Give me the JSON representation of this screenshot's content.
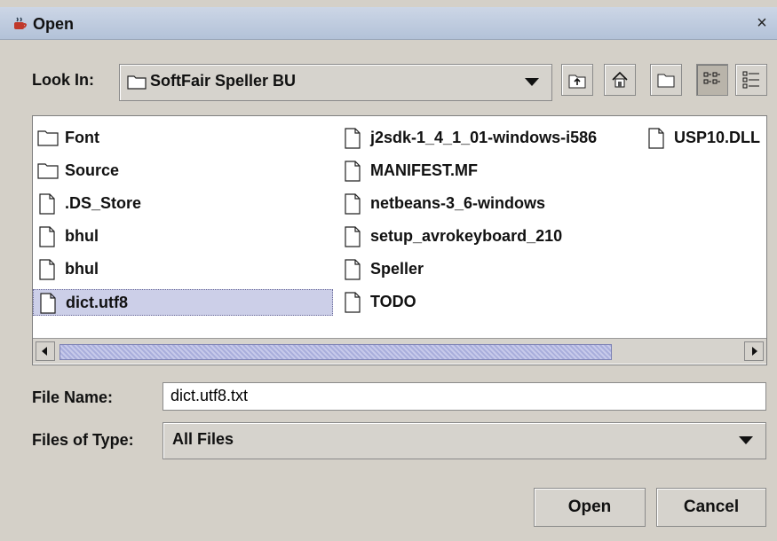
{
  "window": {
    "title": "Open",
    "close_glyph": "×",
    "icon": "java-coffee-cup-icon"
  },
  "look_in": {
    "label": "Look In:",
    "selected_folder": "SoftFair Speller BU",
    "toolbar": {
      "up_icon": "up-one-level-icon",
      "home_icon": "home-icon",
      "new_folder_icon": "new-folder-icon",
      "list_view_icon": "list-view-icon",
      "details_view_icon": "details-view-icon"
    }
  },
  "files": {
    "column1": [
      {
        "name": "Font",
        "type": "folder"
      },
      {
        "name": "Source",
        "type": "folder"
      },
      {
        "name": ".DS_Store",
        "type": "file"
      },
      {
        "name": "bhul",
        "type": "file"
      },
      {
        "name": "bhul",
        "type": "file"
      },
      {
        "name": "dict.utf8",
        "type": "file",
        "selected": true
      }
    ],
    "column2": [
      {
        "name": "j2sdk-1_4_1_01-windows-i586",
        "type": "file"
      },
      {
        "name": "MANIFEST.MF",
        "type": "file"
      },
      {
        "name": "netbeans-3_6-windows",
        "type": "file"
      },
      {
        "name": "setup_avrokeyboard_210",
        "type": "file"
      },
      {
        "name": "Speller",
        "type": "file"
      },
      {
        "name": "TODO",
        "type": "file"
      }
    ],
    "column3": [
      {
        "name": "USP10.DLL",
        "type": "file"
      }
    ]
  },
  "file_name": {
    "label": "File Name:",
    "value": "dict.utf8.txt"
  },
  "files_of_type": {
    "label": "Files of Type:",
    "value": "All Files"
  },
  "buttons": {
    "open": "Open",
    "cancel": "Cancel"
  },
  "colors": {
    "selection": "#cccfe8",
    "titlebar": "#b3c2d8",
    "panel": "#d4d0c8"
  }
}
